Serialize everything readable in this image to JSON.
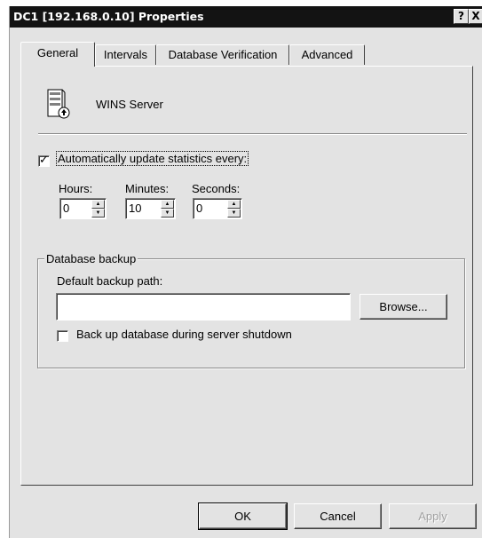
{
  "window": {
    "title": "DC1 [192.168.0.10] Properties"
  },
  "titlebar": {
    "help": "?",
    "close": "X"
  },
  "tabs": [
    "General",
    "Intervals",
    "Database Verification",
    "Advanced"
  ],
  "general": {
    "server_label": "WINS Server",
    "auto_update": {
      "checked": true,
      "label": "Automatically update statistics every:"
    },
    "interval": {
      "hours": {
        "label": "Hours:",
        "value": "0"
      },
      "minutes": {
        "label": "Minutes:",
        "value": "10"
      },
      "seconds": {
        "label": "Seconds:",
        "value": "0"
      }
    },
    "backup": {
      "group_title": "Database backup",
      "path_label": "Default backup path:",
      "path_value": "",
      "browse_label": "Browse...",
      "shutdown_checkbox": {
        "checked": false,
        "label": "Back up database during server shutdown"
      }
    }
  },
  "footer": {
    "ok": "OK",
    "cancel": "Cancel",
    "apply": "Apply"
  },
  "icons": {
    "server": "server-icon"
  }
}
